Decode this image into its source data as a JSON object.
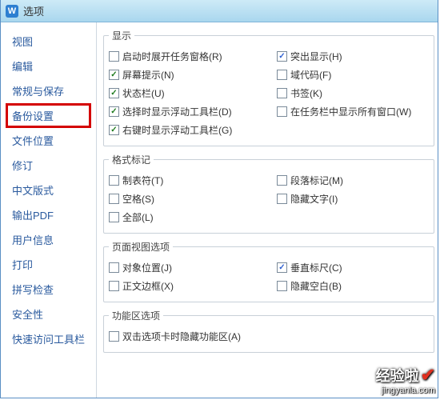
{
  "window": {
    "title": "选项"
  },
  "sidebar": {
    "items": [
      {
        "label": "视图"
      },
      {
        "label": "编辑"
      },
      {
        "label": "常规与保存"
      },
      {
        "label": "备份设置"
      },
      {
        "label": "文件位置"
      },
      {
        "label": "修订"
      },
      {
        "label": "中文版式"
      },
      {
        "label": "输出PDF"
      },
      {
        "label": "用户信息"
      },
      {
        "label": "打印"
      },
      {
        "label": "拼写检查"
      },
      {
        "label": "安全性"
      },
      {
        "label": "快速访问工具栏"
      }
    ]
  },
  "sections": {
    "display": {
      "title": "显示",
      "items": [
        {
          "label": "启动时展开任务窗格(R)",
          "checked": false
        },
        {
          "label": "突出显示(H)",
          "checked": true
        },
        {
          "label": "屏幕提示(N)",
          "checked": true
        },
        {
          "label": "域代码(F)",
          "checked": false
        },
        {
          "label": "状态栏(U)",
          "checked": true
        },
        {
          "label": "书签(K)",
          "checked": false
        },
        {
          "label": "选择时显示浮动工具栏(D)",
          "checked": true
        },
        {
          "label": "在任务栏中显示所有窗口(W)",
          "checked": false
        },
        {
          "label": "右键时显示浮动工具栏(G)",
          "checked": true
        }
      ]
    },
    "format": {
      "title": "格式标记",
      "items": [
        {
          "label": "制表符(T)",
          "checked": false
        },
        {
          "label": "段落标记(M)",
          "checked": false
        },
        {
          "label": "空格(S)",
          "checked": false
        },
        {
          "label": "隐藏文字(I)",
          "checked": false
        },
        {
          "label": "全部(L)",
          "checked": false
        }
      ]
    },
    "pageview": {
      "title": "页面视图选项",
      "items": [
        {
          "label": "对象位置(J)",
          "checked": false
        },
        {
          "label": "垂直标尺(C)",
          "checked": true
        },
        {
          "label": "正文边框(X)",
          "checked": false
        },
        {
          "label": "隐藏空白(B)",
          "checked": false
        }
      ]
    },
    "ribbon": {
      "title": "功能区选项",
      "items": [
        {
          "label": "双击选项卡时隐藏功能区(A)",
          "checked": false
        }
      ]
    }
  },
  "watermark": {
    "main": "经验啦",
    "sub": "jingyanla.com"
  }
}
